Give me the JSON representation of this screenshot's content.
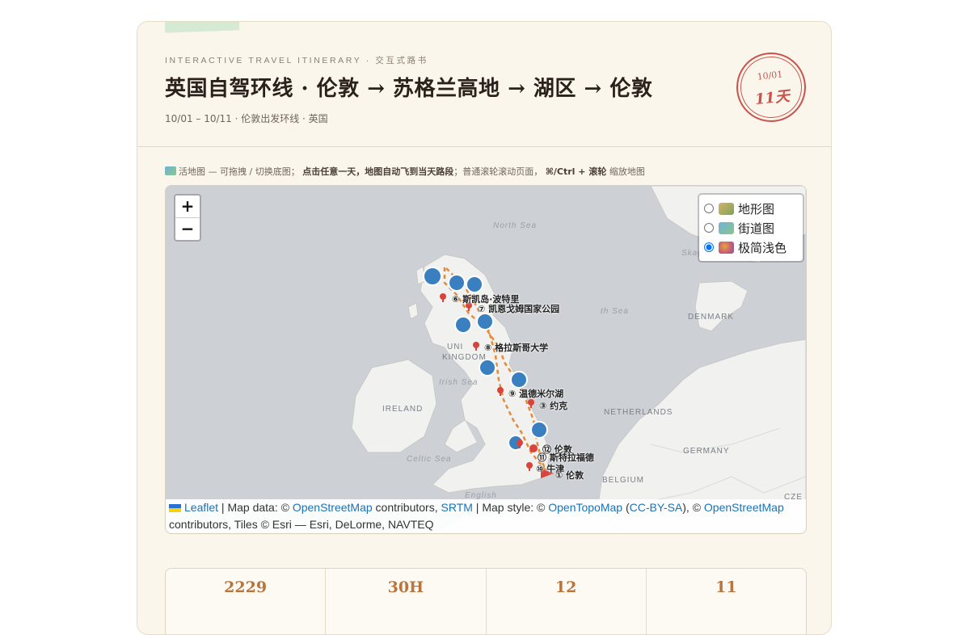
{
  "header": {
    "eyebrow": "INTERACTIVE TRAVEL ITINERARY · 交互式路书",
    "title": "英国自驾环线 · 伦敦 → 苏格兰高地 → 湖区 → 伦敦",
    "subtitle": "10/01 – 10/11 · 伦敦出发环线 · 英国",
    "stamp_date": "10/01",
    "stamp_days": "11天"
  },
  "hint": {
    "part1": "活地图 — 可拖拽 / 切换底图；",
    "part2": "点击任意一天，地图自动飞到当天路段",
    "part3": "；普通滚轮滚动页面，",
    "part4": "⌘/Ctrl + 滚轮",
    "part5": "缩放地图"
  },
  "map": {
    "zoom_in": "+",
    "zoom_out": "−",
    "layers": [
      {
        "label": "地形图",
        "icon": "terrain-icon",
        "checked": false
      },
      {
        "label": "街道图",
        "icon": "street-map-icon",
        "checked": false
      },
      {
        "label": "极简浅色",
        "icon": "palette-icon",
        "checked": true
      }
    ],
    "regions": {
      "north_sea": "North Sea",
      "sea2": "th Sea",
      "denmark": "DENMARK",
      "uk1": "UNI",
      "uk2": "KINGDOM",
      "irish_sea": "Irish Sea",
      "ireland": "IRELAND",
      "netherlands": "NETHERLANDS",
      "germany": "GERMANY",
      "belgium": "BELGIUM",
      "celtic_sea": "Celtic Sea",
      "english": "English",
      "skag": "Skag",
      "czech": "CZE"
    },
    "places": [
      {
        "label": "⑥ 斯凯岛·波特里"
      },
      {
        "label": "⑦ 凯恩戈姆国家公园"
      },
      {
        "label": "⑧ 格拉斯哥大学"
      },
      {
        "label": "⑨ 温德米尔湖"
      },
      {
        "label": "③ 约克"
      },
      {
        "label": "⑫ 伦敦"
      },
      {
        "label": "⑪ 斯特拉福德"
      },
      {
        "label": "⑩ 牛津"
      },
      {
        "label": "① 伦敦"
      }
    ],
    "attribution": {
      "leaflet": "Leaflet",
      "t1": " | Map data: © ",
      "osm": "OpenStreetMap",
      "t2": " contributors, ",
      "srtm": "SRTM",
      "t3": " | Map style: © ",
      "otm": "OpenTopoMap",
      "t4": " (",
      "cc": "CC-BY-SA",
      "t5": "), © ",
      "osm2": "OpenStreetMap",
      "t6": " contributors, Tiles © Esri — Esri, DeLorme, NAVTEQ"
    }
  },
  "stats": [
    {
      "value": "2229"
    },
    {
      "value": "30H"
    },
    {
      "value": "12"
    },
    {
      "value": "11"
    }
  ],
  "colors": {
    "accent": "#b8763e",
    "stamp": "#c9544e",
    "route": "#e58a3a",
    "marker": "#d9433b",
    "card_bg": "#faf6ec"
  }
}
